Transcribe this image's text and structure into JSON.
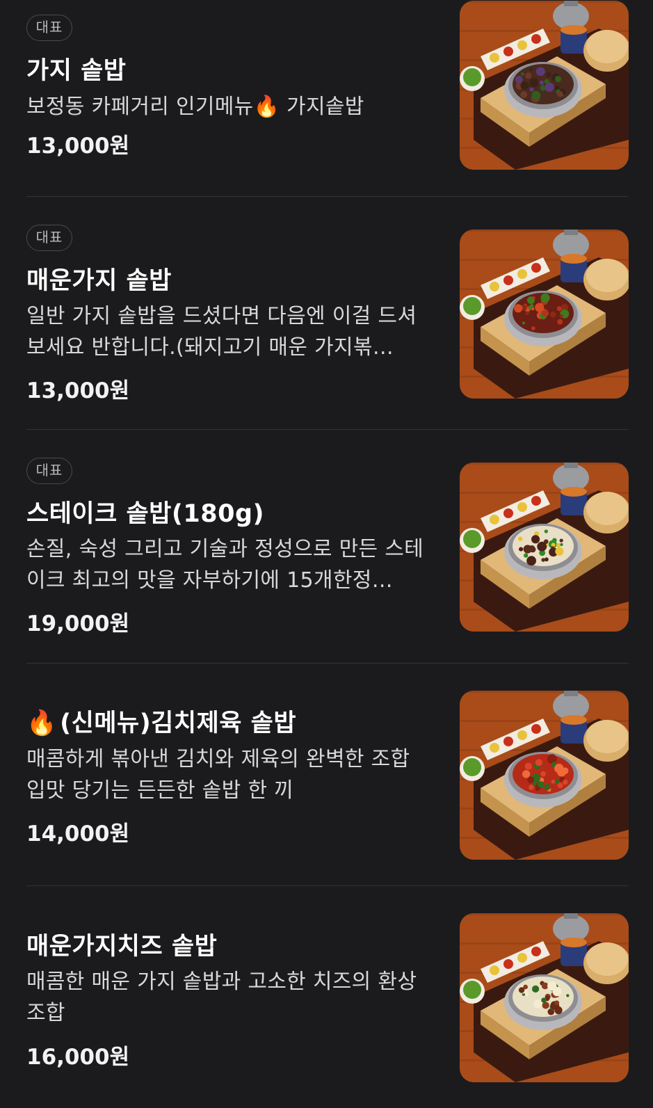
{
  "menu": {
    "items": [
      {
        "badge": "대표",
        "name": "가지 솥밥",
        "name_icon": "",
        "description": "보정동 카페거리 인기메뉴🔥 가지솥밥",
        "price": "13,000원",
        "image": "eggplant-sotbap-photo",
        "topping": "eggplant"
      },
      {
        "badge": "대표",
        "name": "매운가지 솥밥",
        "name_icon": "",
        "description": "일반 가지 솥밥을 드셨다면 다음엔 이걸 드셔보세요 반합니다.(돼지고기 매운 가지볶…",
        "price": "13,000원",
        "image": "spicy-eggplant-sotbap-photo",
        "topping": "spicy"
      },
      {
        "badge": "대표",
        "name": "스테이크 솥밥(180g)",
        "name_icon": "",
        "description": "손질, 숙성 그리고 기술과 정성으로 만든 스테이크 최고의 맛을 자부하기에 15개한정…",
        "price": "19,000원",
        "image": "steak-sotbap-photo",
        "topping": "steak"
      },
      {
        "badge": "",
        "name": "(신메뉴)김치제육 솥밥",
        "name_icon": "🔥",
        "description": "매콤하게 볶아낸 김치와 제육의 완벽한 조합 입맛 당기는 든든한 솥밥 한 끼",
        "price": "14,000원",
        "image": "kimchi-pork-sotbap-photo",
        "topping": "kimchi"
      },
      {
        "badge": "",
        "name": "매운가지치즈 솥밥",
        "name_icon": "",
        "description": "매콤한 매운 가지 솥밥과 고소한 치즈의 환상 조합",
        "price": "16,000원",
        "image": "spicy-eggplant-cheese-sotbap-photo",
        "topping": "cheese"
      }
    ]
  },
  "colors": {
    "background": "#1b1b1d",
    "divider": "#333336",
    "badge_border": "#4a4a4e",
    "wood": "#b0521c"
  }
}
